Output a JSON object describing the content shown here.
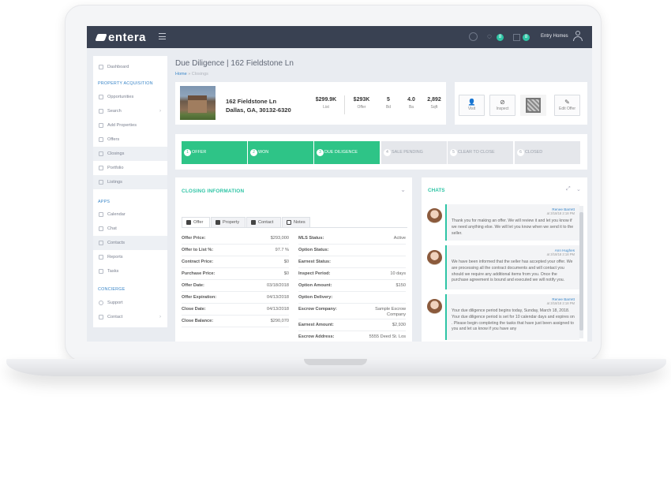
{
  "app": {
    "logo_text": "entera",
    "user_name": "Entry Homes",
    "badge_1": "8",
    "badge_2": "8",
    "accent_color": "#2ec4a5",
    "topbar_color": "#394152"
  },
  "sidebar": {
    "items": [
      {
        "label": "Dashboard",
        "icon": "dashboard-icon"
      },
      {
        "label": "Opportunities",
        "icon": "key-icon"
      },
      {
        "label": "Search",
        "icon": "search-icon"
      },
      {
        "label": "Add Properties",
        "icon": "upload-icon"
      },
      {
        "label": "Offers",
        "icon": "tag-icon"
      },
      {
        "label": "Closings",
        "icon": "file-icon"
      },
      {
        "label": "Portfolio",
        "icon": "grid-icon"
      },
      {
        "label": "Listings",
        "icon": "handshake-icon"
      },
      {
        "label": "Calendar",
        "icon": "calendar-icon"
      },
      {
        "label": "Chat",
        "icon": "chat-icon"
      },
      {
        "label": "Contacts",
        "icon": "user-icon"
      },
      {
        "label": "Reports",
        "icon": "chart-icon"
      },
      {
        "label": "Tasks",
        "icon": "list-icon"
      },
      {
        "label": "Support",
        "icon": "support-icon"
      },
      {
        "label": "Contact",
        "icon": "mail-icon"
      }
    ],
    "sections": [
      "PROPERTY ACQUISITION",
      "APPS",
      "CONCIERGE"
    ]
  },
  "page": {
    "title": "Due Diligence | 162 Fieldstone Ln",
    "breadcrumb_home": "Home",
    "breadcrumb_sep": "»",
    "breadcrumb_current": "Closings"
  },
  "property": {
    "address_line1": "162 Fieldstone Ln",
    "address_line2": "Dallas, GA, 30132-6320",
    "stats": [
      {
        "value": "$299.9K",
        "label": "List"
      },
      {
        "value": "$293K",
        "label": "Offer"
      },
      {
        "value": "5",
        "label": "Bd"
      },
      {
        "value": "4.0",
        "label": "Ba"
      },
      {
        "value": "2,892",
        "label": "Sqft"
      }
    ]
  },
  "actions": [
    {
      "label": "Visit",
      "icon": "add-user-icon"
    },
    {
      "label": "Inspect",
      "icon": "check-circle-icon"
    },
    {
      "label": "",
      "icon": "home-depot-logo-icon"
    },
    {
      "label": "Edit Offer",
      "icon": "edit-icon"
    }
  ],
  "steps": [
    {
      "num": "1",
      "label": "OFFER",
      "done": true
    },
    {
      "num": "2",
      "label": "WON",
      "done": true
    },
    {
      "num": "3",
      "label": "DUE DILIGENCE",
      "done": true
    },
    {
      "num": "4",
      "label": "SALE PENDING",
      "done": false
    },
    {
      "num": "5",
      "label": "CLEAR TO CLOSE",
      "done": false
    },
    {
      "num": "6",
      "label": "CLOSED",
      "done": false
    }
  ],
  "closing": {
    "title": "CLOSING INFORMATION",
    "tabs": [
      "Offer",
      "Property",
      "Contact",
      "Notes"
    ],
    "left_rows": [
      {
        "k": "Offer Price:",
        "v": "$293,000"
      },
      {
        "k": "Offer to List %:",
        "v": "97.7 %"
      },
      {
        "k": "Contract Price:",
        "v": "$0"
      },
      {
        "k": "Purchase Price:",
        "v": "$0"
      },
      {
        "k": "Offer Date:",
        "v": "03/18/2018"
      },
      {
        "k": "Offer Expiration:",
        "v": "04/13/2018"
      },
      {
        "k": "Close Date:",
        "v": "04/13/2018"
      },
      {
        "k": "Close Balance:",
        "v": "$290,070"
      }
    ],
    "right_rows": [
      {
        "k": "MLS Status:",
        "v": "Active"
      },
      {
        "k": "Option Status:",
        "v": ""
      },
      {
        "k": "Earnest Status:",
        "v": ""
      },
      {
        "k": "Inspect Period:",
        "v": "10 days"
      },
      {
        "k": "Option Amount:",
        "v": "$150"
      },
      {
        "k": "Option Delivery:",
        "v": ""
      },
      {
        "k": "Escrow Company:",
        "v": "Sample Escrow Company"
      },
      {
        "k": "Earnest Amount:",
        "v": "$2,930"
      },
      {
        "k": "Escrow Address:",
        "v": "5555 Deed St. Los"
      }
    ]
  },
  "chats": {
    "title": "CHATS",
    "messages": [
      {
        "name": "Renee Barrett",
        "date": "at 3/18/18 2:18 PM",
        "text": "Thank you for making an offer. We will review it and let you know if we need anything else. We will let you know when we send it to the seller."
      },
      {
        "name": "Ann Hughes",
        "date": "at 3/18/18 2:18 PM",
        "text": "We have been informed that the seller has accepted your offer. We are processing all the contract documents and will contact you should we require any additional items from you. Once the purchase agreement is bound and executed we will notify you."
      },
      {
        "name": "Renee Barrett",
        "date": "at 3/18/18 2:18 PM",
        "text": "Your due diligence period begins today, Sunday, March 18, 2018. Your due diligence period is set for 10 calendar days and expires on . Please begin completing the tasks that have just been assigned to you and let us know if you have any"
      }
    ]
  }
}
